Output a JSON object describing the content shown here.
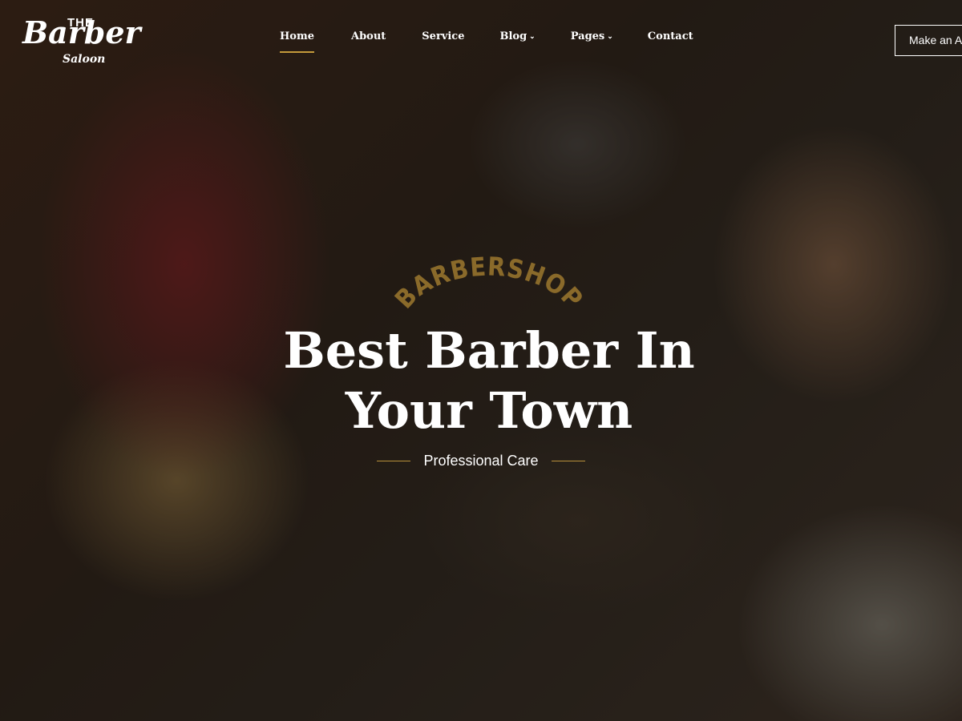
{
  "logo": {
    "the": "THE",
    "barber": "Barber",
    "saloon": "Saloon"
  },
  "nav": {
    "items": [
      {
        "label": "Home",
        "active": true
      },
      {
        "label": "About"
      },
      {
        "label": "Service"
      },
      {
        "label": "Blog",
        "dropdown": true
      },
      {
        "label": "Pages",
        "dropdown": true
      },
      {
        "label": "Contact"
      }
    ]
  },
  "cta": {
    "label": "Make an Appointment"
  },
  "hero": {
    "kicker": "BARBERSHOP",
    "headline_line1": "Best Barber In",
    "headline_line2": "Your Town",
    "tagline": "Professional Care"
  },
  "colors": {
    "accent": "#c49a3b",
    "kicker": "#8a6a2a",
    "text": "#ffffff"
  }
}
